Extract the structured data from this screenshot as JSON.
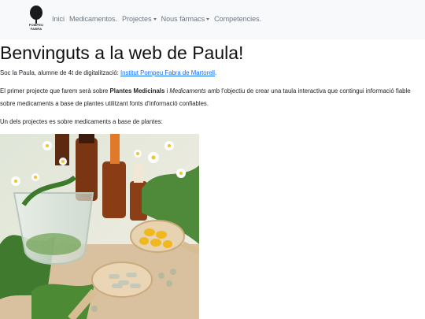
{
  "brand": {
    "name_line1": "POMPEU",
    "name_line2": "FABRA"
  },
  "nav": {
    "items": [
      {
        "label": "Inici",
        "dropdown": false
      },
      {
        "label": "Medicamentos.",
        "dropdown": false
      },
      {
        "label": "Projectes",
        "dropdown": true
      },
      {
        "label": "Nous fàrmacs",
        "dropdown": true
      },
      {
        "label": "Competencies.",
        "dropdown": false
      }
    ]
  },
  "main": {
    "title": "Benvinguts a la web de Paula!",
    "intro_text": "Soc la Paula, alumne de 4t de digitalització: ",
    "intro_link": "Institut Pompeu Fabra de Martorell",
    "intro_end": ".",
    "project_p_start": "El primer projecte que farem serà sobre ",
    "project_bold": "Plantes Medicinals",
    "project_mid": " i ",
    "project_italic": "Medicaments",
    "project_end": " amb l'objectiu de crear una taula interactiva que contingui informació fiable sobre medicaments a base de plantes utilitzant fonts d'informació confiables.",
    "one_project": "Un dels projectes es sobre medicaments a base de plantes:"
  },
  "colors": {
    "navbar_bg": "#f8f9fa",
    "link": "#0d6efd",
    "nav_text": "#6c757d"
  }
}
